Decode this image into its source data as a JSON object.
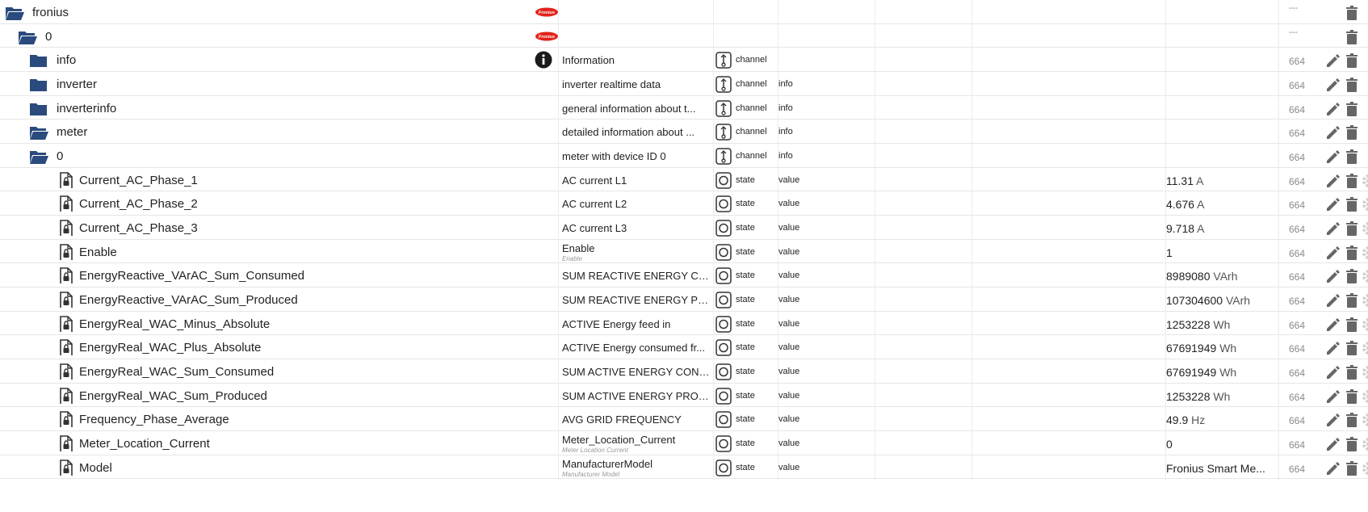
{
  "logo_text": "Fronius",
  "rows": [
    {
      "name": "fronius",
      "level": 0,
      "kind": "folder-open",
      "badge": "fronius",
      "desc": "",
      "desc_sub": "",
      "type": "",
      "role": "",
      "value": "",
      "unit": "",
      "acl": "---",
      "edit": false,
      "gear": false
    },
    {
      "name": "0",
      "level": 1,
      "kind": "folder-open",
      "badge": "fronius",
      "desc": "",
      "desc_sub": "",
      "type": "",
      "role": "",
      "value": "",
      "unit": "",
      "acl": "---",
      "edit": false,
      "gear": false
    },
    {
      "name": "info",
      "level": 2,
      "kind": "folder",
      "badge": "info",
      "desc": "Information",
      "desc_sub": "",
      "type": "channel",
      "role": "",
      "value": "",
      "unit": "",
      "acl": "664",
      "edit": true,
      "gear": false
    },
    {
      "name": "inverter",
      "level": 2,
      "kind": "folder",
      "badge": "",
      "desc": "inverter realtime data",
      "desc_sub": "",
      "type": "channel",
      "role": "info",
      "value": "",
      "unit": "",
      "acl": "664",
      "edit": true,
      "gear": false
    },
    {
      "name": "inverterinfo",
      "level": 2,
      "kind": "folder",
      "badge": "",
      "desc": "general information about t...",
      "desc_sub": "",
      "type": "channel",
      "role": "info",
      "value": "",
      "unit": "",
      "acl": "664",
      "edit": true,
      "gear": false
    },
    {
      "name": "meter",
      "level": 2,
      "kind": "folder-open",
      "badge": "",
      "desc": "detailed information about ...",
      "desc_sub": "",
      "type": "channel",
      "role": "info",
      "value": "",
      "unit": "",
      "acl": "664",
      "edit": true,
      "gear": false
    },
    {
      "name": "0",
      "level": 3,
      "kind": "folder-open",
      "badge": "",
      "desc": "meter with device ID 0",
      "desc_sub": "",
      "type": "channel",
      "role": "info",
      "value": "",
      "unit": "",
      "acl": "664",
      "edit": true,
      "gear": false
    },
    {
      "name": "Current_AC_Phase_1",
      "level": 4,
      "kind": "file",
      "badge": "",
      "desc": "AC current L1",
      "desc_sub": "",
      "type": "state",
      "role": "value",
      "value": "11.31",
      "unit": "A",
      "acl": "664",
      "edit": true,
      "gear": true
    },
    {
      "name": "Current_AC_Phase_2",
      "level": 4,
      "kind": "file",
      "badge": "",
      "desc": "AC current L2",
      "desc_sub": "",
      "type": "state",
      "role": "value",
      "value": "4.676",
      "unit": "A",
      "acl": "664",
      "edit": true,
      "gear": true
    },
    {
      "name": "Current_AC_Phase_3",
      "level": 4,
      "kind": "file",
      "badge": "",
      "desc": "AC current L3",
      "desc_sub": "",
      "type": "state",
      "role": "value",
      "value": "9.718",
      "unit": "A",
      "acl": "664",
      "edit": true,
      "gear": true
    },
    {
      "name": "Enable",
      "level": 4,
      "kind": "file",
      "badge": "",
      "desc": "Enable",
      "desc_sub": "Enable",
      "type": "state",
      "role": "value",
      "value": "1",
      "unit": "",
      "acl": "664",
      "edit": true,
      "gear": true
    },
    {
      "name": "EnergyReactive_VArAC_Sum_Consumed",
      "level": 4,
      "kind": "file",
      "badge": "",
      "desc": "SUM REACTIVE ENERGY CO...",
      "desc_sub": "",
      "type": "state",
      "role": "value",
      "value": "8989080",
      "unit": "VArh",
      "acl": "664",
      "edit": true,
      "gear": true
    },
    {
      "name": "EnergyReactive_VArAC_Sum_Produced",
      "level": 4,
      "kind": "file",
      "badge": "",
      "desc": "SUM REACTIVE ENERGY PR...",
      "desc_sub": "",
      "type": "state",
      "role": "value",
      "value": "107304600",
      "unit": "VArh",
      "acl": "664",
      "edit": true,
      "gear": true
    },
    {
      "name": "EnergyReal_WAC_Minus_Absolute",
      "level": 4,
      "kind": "file",
      "badge": "",
      "desc": "ACTIVE Energy feed in",
      "desc_sub": "",
      "type": "state",
      "role": "value",
      "value": "1253228",
      "unit": "Wh",
      "acl": "664",
      "edit": true,
      "gear": true
    },
    {
      "name": "EnergyReal_WAC_Plus_Absolute",
      "level": 4,
      "kind": "file",
      "badge": "",
      "desc": "ACTIVE Energy consumed fr...",
      "desc_sub": "",
      "type": "state",
      "role": "value",
      "value": "67691949",
      "unit": "Wh",
      "acl": "664",
      "edit": true,
      "gear": true
    },
    {
      "name": "EnergyReal_WAC_Sum_Consumed",
      "level": 4,
      "kind": "file",
      "badge": "",
      "desc": "SUM ACTIVE ENERGY CONS...",
      "desc_sub": "",
      "type": "state",
      "role": "value",
      "value": "67691949",
      "unit": "Wh",
      "acl": "664",
      "edit": true,
      "gear": true
    },
    {
      "name": "EnergyReal_WAC_Sum_Produced",
      "level": 4,
      "kind": "file",
      "badge": "",
      "desc": "SUM ACTIVE ENERGY PROD...",
      "desc_sub": "",
      "type": "state",
      "role": "value",
      "value": "1253228",
      "unit": "Wh",
      "acl": "664",
      "edit": true,
      "gear": true
    },
    {
      "name": "Frequency_Phase_Average",
      "level": 4,
      "kind": "file",
      "badge": "",
      "desc": "AVG GRID FREQUENCY",
      "desc_sub": "",
      "type": "state",
      "role": "value",
      "value": "49.9",
      "unit": "Hz",
      "acl": "664",
      "edit": true,
      "gear": true
    },
    {
      "name": "Meter_Location_Current",
      "level": 4,
      "kind": "file",
      "badge": "",
      "desc": "Meter_Location_Current",
      "desc_sub": "Meter Location Current",
      "type": "state",
      "role": "value",
      "value": "0",
      "unit": "",
      "acl": "664",
      "edit": true,
      "gear": true
    },
    {
      "name": "Model",
      "level": 4,
      "kind": "file",
      "badge": "",
      "desc": "ManufacturerModel",
      "desc_sub": "Manufacturer Model",
      "type": "state",
      "role": "value",
      "value": "Fronius Smart Me...",
      "unit": "",
      "acl": "664",
      "edit": true,
      "gear": true
    }
  ]
}
